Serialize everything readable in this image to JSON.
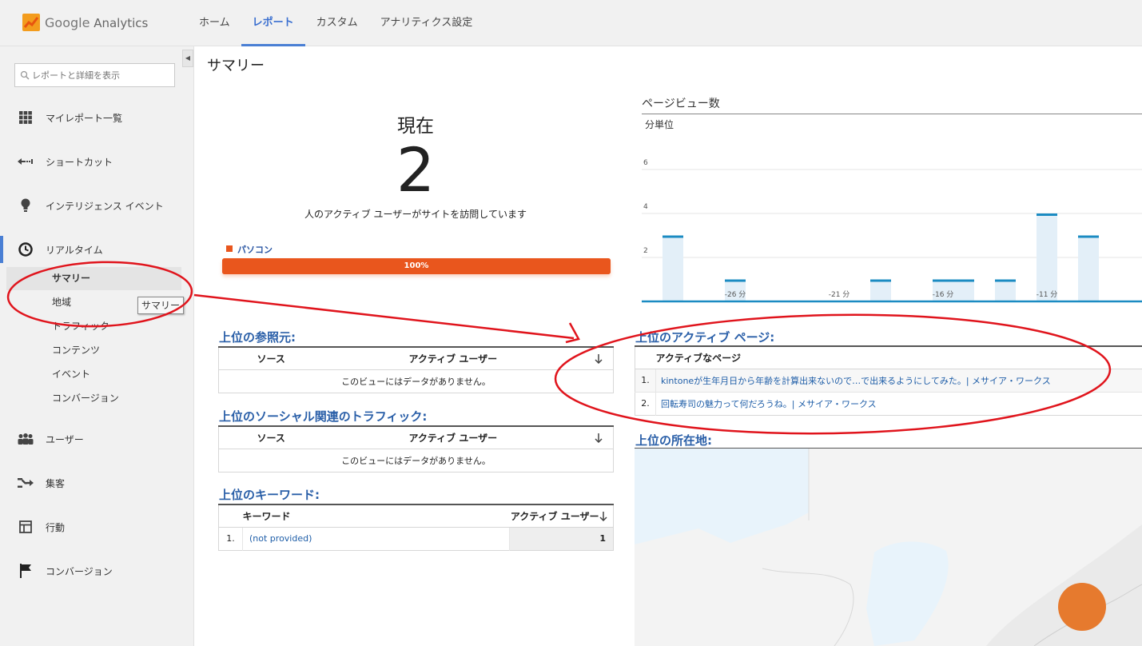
{
  "app": {
    "brand_google": "Google",
    "brand_product": "Analytics"
  },
  "nav": [
    {
      "label": "ホーム",
      "active": false
    },
    {
      "label": "レポート",
      "active": true
    },
    {
      "label": "カスタム",
      "active": false
    },
    {
      "label": "アナリティクス設定",
      "active": false
    }
  ],
  "sidebar": {
    "search_placeholder": "レポートと詳細を表示",
    "items": [
      {
        "label": "マイレポート一覧",
        "icon": "grid-icon"
      },
      {
        "label": "ショートカット",
        "icon": "shortcut-icon"
      },
      {
        "label": "インテリジェンス イベント",
        "icon": "lightbulb-icon"
      },
      {
        "label": "リアルタイム",
        "icon": "clock-icon"
      },
      {
        "label": "ユーザー",
        "icon": "users-icon"
      },
      {
        "label": "集客",
        "icon": "acquisition-icon"
      },
      {
        "label": "行動",
        "icon": "behavior-icon"
      },
      {
        "label": "コンバージョン",
        "icon": "flag-icon"
      }
    ],
    "realtime_sub": [
      {
        "label": "サマリー",
        "selected": true
      },
      {
        "label": "地域",
        "selected": false
      },
      {
        "label": "トラフィック",
        "selected": false
      },
      {
        "label": "コンテンツ",
        "selected": false
      },
      {
        "label": "イベント",
        "selected": false
      },
      {
        "label": "コンバージョン",
        "selected": false
      }
    ],
    "tooltip": "サマリー"
  },
  "main": {
    "title": "サマリー",
    "now_label": "現在",
    "active_count": "2",
    "active_desc": "人のアクティブ ユーザーがサイトを訪問しています",
    "device_legend": "パソコン",
    "device_percent_label": "100%",
    "device_fraction": 1.0,
    "referrers": {
      "title": "上位の参照元:",
      "col_source": "ソース",
      "col_users": "アクティブ ユーザー",
      "empty": "このビューにはデータがありません。"
    },
    "social": {
      "title": "上位のソーシャル関連のトラフィック:",
      "col_source": "ソース",
      "col_users": "アクティブ ユーザー",
      "empty": "このビューにはデータがありません。"
    },
    "keywords": {
      "title": "上位のキーワード:",
      "col_keyword": "キーワード",
      "col_users": "アクティブ ユーザー",
      "rows": [
        {
          "num": "1.",
          "keyword": "(not provided)",
          "users": "1"
        }
      ]
    },
    "active_pages": {
      "title": "上位のアクティブ ページ:",
      "col_page": "アクティブなページ",
      "rows": [
        {
          "num": "1.",
          "page": "kintoneが生年月日から年齢を計算出来ないので…で出来るようにしてみた。| メサイア・ワークス"
        },
        {
          "num": "2.",
          "page": "回転寿司の魅力って何だろうね。| メサイア・ワークス"
        }
      ]
    },
    "locations": {
      "title": "上位の所在地:"
    }
  },
  "colors": {
    "accent_blue": "#2a5fa8",
    "device_orange": "#e9561d",
    "chart_bar": "#1b8bc2",
    "chart_fill": "#e3eff8",
    "annotation_red": "#e0141c",
    "map_dot": "#e67a2e"
  },
  "chart_data": {
    "type": "bar",
    "title": "ページビュー数",
    "subtitle": "分単位",
    "xlabel": "",
    "ylabel": "",
    "ylim": [
      0,
      6
    ],
    "yticks": [
      2,
      4,
      6
    ],
    "x_tick_labels": [
      {
        "minute": -26,
        "label": "-26 分"
      },
      {
        "minute": -21,
        "label": "-21 分"
      },
      {
        "minute": -16,
        "label": "-16 分"
      },
      {
        "minute": -11,
        "label": "-11 分"
      }
    ],
    "minutes": [
      -30,
      -29,
      -28,
      -27,
      -26,
      -25,
      -24,
      -23,
      -22,
      -21,
      -20,
      -19,
      -18,
      -17,
      -16,
      -15,
      -14,
      -13,
      -12,
      -11,
      -10,
      -9,
      -8,
      -7,
      -6
    ],
    "values": [
      0,
      3,
      0,
      0,
      1,
      0,
      0,
      0,
      0,
      0,
      0,
      1,
      0,
      0,
      1,
      1,
      0,
      1,
      0,
      4,
      0,
      3,
      0,
      0,
      0
    ],
    "grid": true
  }
}
